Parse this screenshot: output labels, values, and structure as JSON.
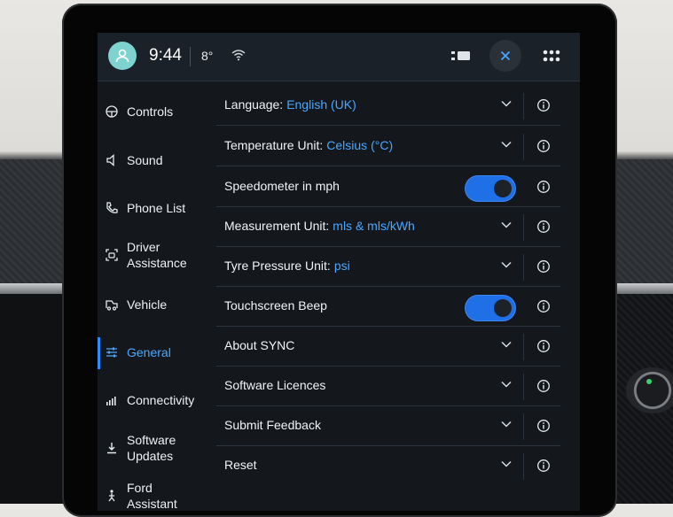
{
  "status_bar": {
    "time": "9:44",
    "temperature": "8°"
  },
  "sidebar": {
    "items": [
      {
        "label": "Controls",
        "icon": "steering-wheel-icon",
        "active": false
      },
      {
        "label": "Sound",
        "icon": "speaker-icon",
        "active": false
      },
      {
        "label": "Phone List",
        "icon": "phone-icon",
        "active": false
      },
      {
        "label": "Driver\nAssistance",
        "icon": "driver-assist-icon",
        "active": false
      },
      {
        "label": "Vehicle",
        "icon": "car-icon",
        "active": false
      },
      {
        "label": "General",
        "icon": "sliders-icon",
        "active": true
      },
      {
        "label": "Connectivity",
        "icon": "signal-bars-icon",
        "active": false
      },
      {
        "label": "Software\nUpdates",
        "icon": "download-icon",
        "active": false
      },
      {
        "label": "Ford Assistant",
        "icon": "assistant-icon",
        "active": false
      }
    ]
  },
  "settings": [
    {
      "label": "Language:",
      "value": "English (UK)",
      "control": "dropdown"
    },
    {
      "label": "Temperature Unit:",
      "value": "Celsius (°C)",
      "control": "dropdown"
    },
    {
      "label": "Speedometer in mph",
      "value": "",
      "control": "toggle",
      "on": true
    },
    {
      "label": "Measurement Unit:",
      "value": "mls & mls/kWh",
      "control": "dropdown"
    },
    {
      "label": "Tyre Pressure Unit:",
      "value": "psi",
      "control": "dropdown"
    },
    {
      "label": "Touchscreen Beep",
      "value": "",
      "control": "toggle",
      "on": true
    },
    {
      "label": "About SYNC",
      "value": "",
      "control": "dropdown"
    },
    {
      "label": "Software Licences",
      "value": "",
      "control": "dropdown"
    },
    {
      "label": "Submit Feedback",
      "value": "",
      "control": "dropdown"
    },
    {
      "label": "Reset",
      "value": "",
      "control": "dropdown"
    }
  ],
  "colors": {
    "accent": "#4aa6ff",
    "toggle_on": "#1f6fe6",
    "background": "#14181d"
  }
}
